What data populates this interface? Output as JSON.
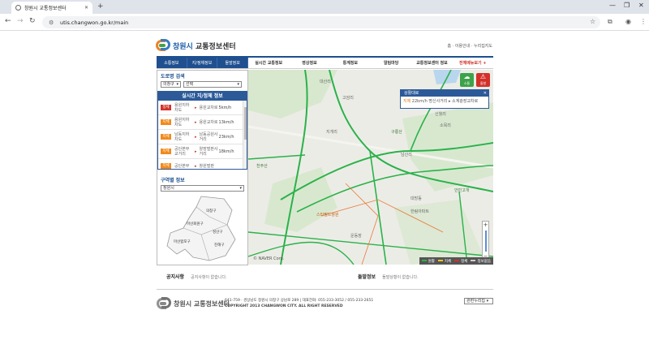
{
  "browser": {
    "tab_title": "창원시 교통정보센터",
    "url": "utis.changwon.go.kr/main"
  },
  "header": {
    "logo_text": "창원시",
    "logo_sub": "교통정보센터",
    "top_links": "홈 · 이용안내 · 누리집지도"
  },
  "nav": {
    "sub_tabs": [
      "소통정보",
      "지/정체정보",
      "돌발정보"
    ],
    "items": [
      "실시간 교통정보",
      "영상정보",
      "통계정보",
      "알림마당",
      "교통정보센터 정보",
      "전체메뉴보기 +"
    ]
  },
  "left": {
    "road_search_title": "도로명 검색",
    "district_select": "의창구",
    "road_select": "선택",
    "realtime_title": "실시간 지/정체 정보",
    "rows": [
      {
        "status": "정체",
        "color": "#d2312a",
        "from": "용원지하차도",
        "to": "용원교차로",
        "speed": "5km/h"
      },
      {
        "status": "지체",
        "color": "#f08a1c",
        "from": "용원지하차도",
        "to": "용원교차로",
        "speed": "13km/h"
      },
      {
        "status": "지체",
        "color": "#f08a1c",
        "from": "남동지하차도",
        "to": "남동공원사거리",
        "speed": "23km/h"
      },
      {
        "status": "지체",
        "color": "#f08a1c",
        "from": "공단본부교거리",
        "to": "양장벌판사거리",
        "speed": "18km/h"
      },
      {
        "status": "지체",
        "color": "#f08a1c",
        "from": "공단본부",
        "to": "창원벌판",
        "speed": ""
      }
    ],
    "zone_title": "구역별 정보",
    "zone_select": "창원시",
    "zones": [
      "의창구",
      "마산회원구",
      "성산구",
      "마산합포구",
      "진해구"
    ]
  },
  "map": {
    "popup_title": "상활대로",
    "popup_status": "지체",
    "popup_text": "22km/h 명신사거리 ▸ 소계광장교차로",
    "btn_green": "소통",
    "btn_red": "돌발",
    "attribution": "© NAVER Corp.",
    "legend": [
      {
        "label": "원활",
        "color": "#2ab24a"
      },
      {
        "label": "지체",
        "color": "#f0c419"
      },
      {
        "label": "정체",
        "color": "#d2312a"
      },
      {
        "label": "정보없음",
        "color": "#cccccc"
      }
    ],
    "labels": [
      "대산리",
      "고암리",
      "지개리",
      "남산리",
      "구룡산",
      "천주산",
      "소목리",
      "신월리",
      "대방동",
      "한림아파트",
      "안민고개",
      "운동장",
      "스타필드창원"
    ]
  },
  "notice": {
    "title": "공지사항",
    "text": "공지사항이 없습니다.",
    "incident_title": "돌발정보",
    "incident_text": "돌발상황이 없습니다."
  },
  "footer": {
    "logo_text": "창원시 교통정보센터",
    "address": "641-759 · 경상남도 창원시 의창구 상남로 289  |  대표전화: 055-233-3052 / 055-233-2651",
    "copyright": "COPYRIGHT 2013 CHANGWON CITY. ALL RIGHT RESERVED",
    "related_select": "관련누리집"
  }
}
